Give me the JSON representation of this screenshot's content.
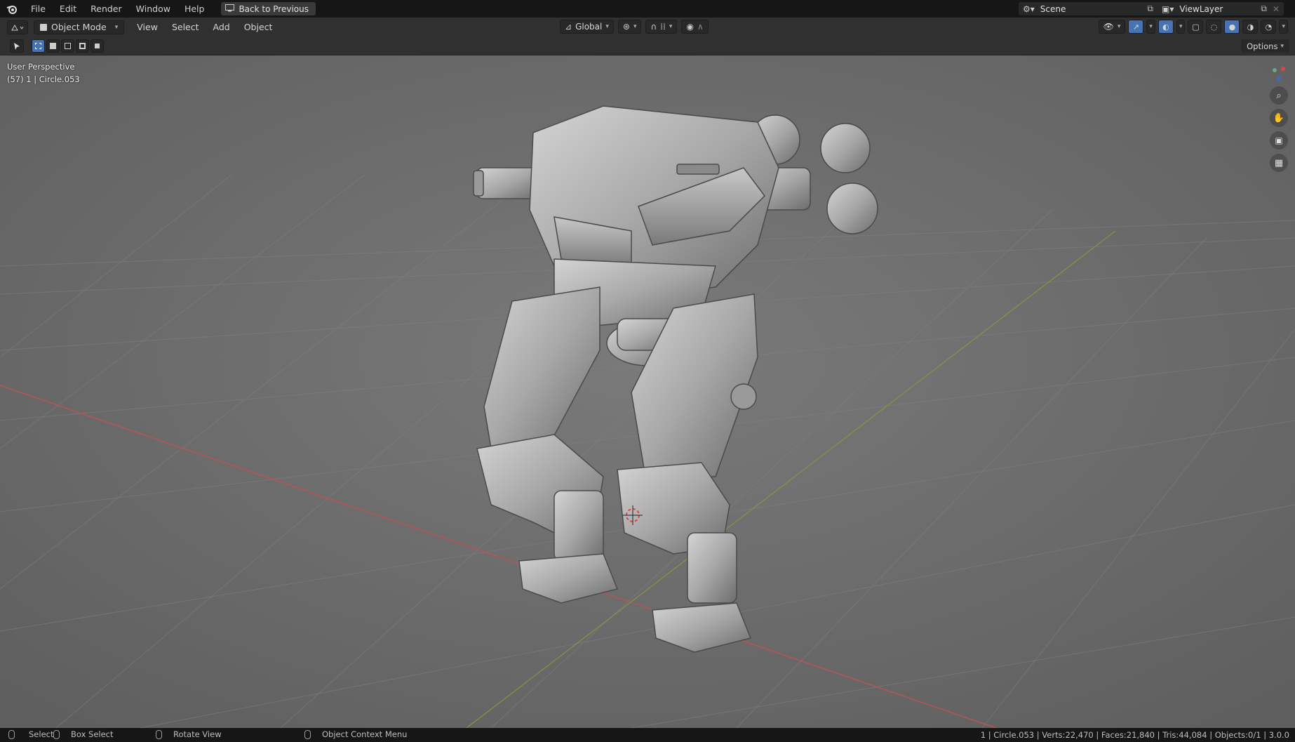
{
  "topbar": {
    "menus": [
      "File",
      "Edit",
      "Render",
      "Window",
      "Help"
    ],
    "back_button": "Back to Previous",
    "scene": "Scene",
    "view_layer": "ViewLayer"
  },
  "header": {
    "mode": "Object Mode",
    "menus": [
      "View",
      "Select",
      "Add",
      "Object"
    ],
    "transform_orientation": "Global",
    "options": "Options"
  },
  "viewport": {
    "perspective": "User Perspective",
    "object_info": "(57) 1 | Circle.053"
  },
  "statusbar": {
    "select": "Select",
    "box_select": "Box Select",
    "rotate_view": "Rotate View",
    "context_menu": "Object Context Menu",
    "stats": "1 | Circle.053 | Verts:22,470 | Faces:21,840 | Tris:44,084 | Objects:0/1 | 3.0.0"
  },
  "colors": {
    "accent": "#4772b3",
    "x_axis": "#b85454",
    "y_axis": "#7c9a3c",
    "viewport_bg": "#6e6e6e"
  }
}
